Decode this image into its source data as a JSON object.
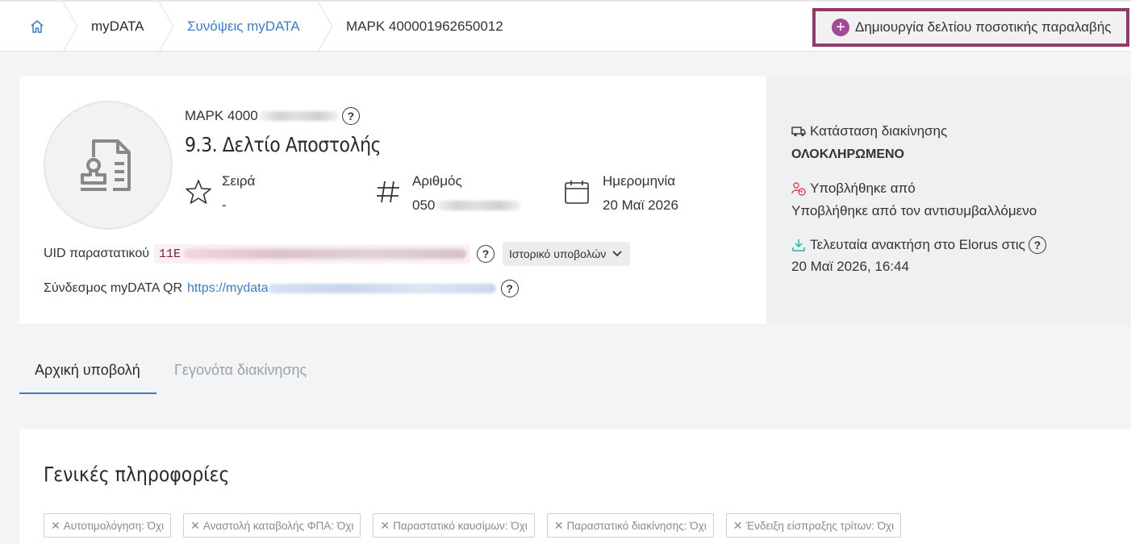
{
  "breadcrumb": {
    "home_icon": "home-icon",
    "items": [
      "myDATA",
      "Συνόψεις myDATA",
      "ΜΑΡΚ 400001962650012"
    ]
  },
  "header": {
    "create_button": "Δημιουργία δελτίου ποσοτικής παραλαβής",
    "accent": "#8e3a6b",
    "plus_color": "#a14a98"
  },
  "document": {
    "mark_prefix": "ΜΑΡΚ 4000",
    "title": "9.3. Δελτίο Αποστολής",
    "series_label": "Σειρά",
    "series_value": "-",
    "number_label": "Αριθμός",
    "number_value": "050",
    "date_label": "Ημερομηνία",
    "date_value": "20 Μαϊ 2026",
    "uid_label": "UID παραστατικού",
    "uid_value": "11E",
    "history_button": "Ιστορικό υποβολών",
    "qr_label": "Σύνδεσμος myDATA QR",
    "qr_link": "https://mydata"
  },
  "side": {
    "status_label": "Κατάσταση διακίνησης",
    "status_value": "ΟΛΟΚΛΗΡΩΜΕΝΟ",
    "submitted_label": "Υποβλήθηκε από",
    "submitted_value": "Υποβλήθηκε από τον αντισυμβαλλόμενο",
    "fetch_label": "Τελευταία ανακτήση στο Elorus στις",
    "fetch_value": "20 Μαϊ 2026, 16:44"
  },
  "tabs": [
    "Αρχική υποβολή",
    "Γεγονότα διακίνησης"
  ],
  "info": {
    "title": "Γενικές πληροφορίες",
    "tags": [
      "Αυτοτιμολόγηση: Όχι",
      "Αναστολή καταβολής ΦΠΑ: Όχι",
      "Παραστατικό καυσίμων: Όχι",
      "Παραστατικό διακίνησης: Όχι",
      "Ένδειξη είσπραξης τρίτων: Όχι"
    ]
  }
}
